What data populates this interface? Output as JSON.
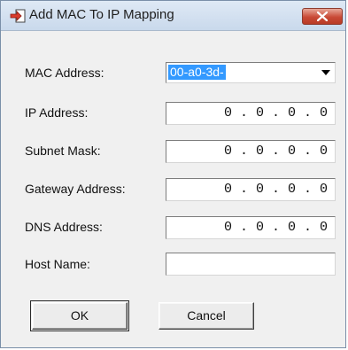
{
  "window": {
    "title": "Add MAC To IP Mapping"
  },
  "fields": {
    "mac_address": {
      "label": "MAC Address:",
      "value": "00-a0-3d-"
    },
    "ip_address": {
      "label": "IP Address:",
      "value": "0 . 0 . 0 . 0"
    },
    "subnet_mask": {
      "label": "Subnet Mask:",
      "value": "0 . 0 . 0 . 0"
    },
    "gateway_address": {
      "label": "Gateway Address:",
      "value": "0 . 0 . 0 . 0"
    },
    "dns_address": {
      "label": "DNS Address:",
      "value": "0 . 0 . 0 . 0"
    },
    "host_name": {
      "label": "Host Name:",
      "value": ""
    }
  },
  "buttons": {
    "ok": "OK",
    "cancel": "Cancel"
  },
  "icons": {
    "app": "arrow-into-box-icon",
    "close": "close-icon",
    "dropdown": "chevron-down-icon"
  },
  "colors": {
    "selection": "#3399ff",
    "close_button": "#c94a36",
    "titlebar": "#c9d9ec",
    "dialog_bg": "#f0f0f0"
  }
}
